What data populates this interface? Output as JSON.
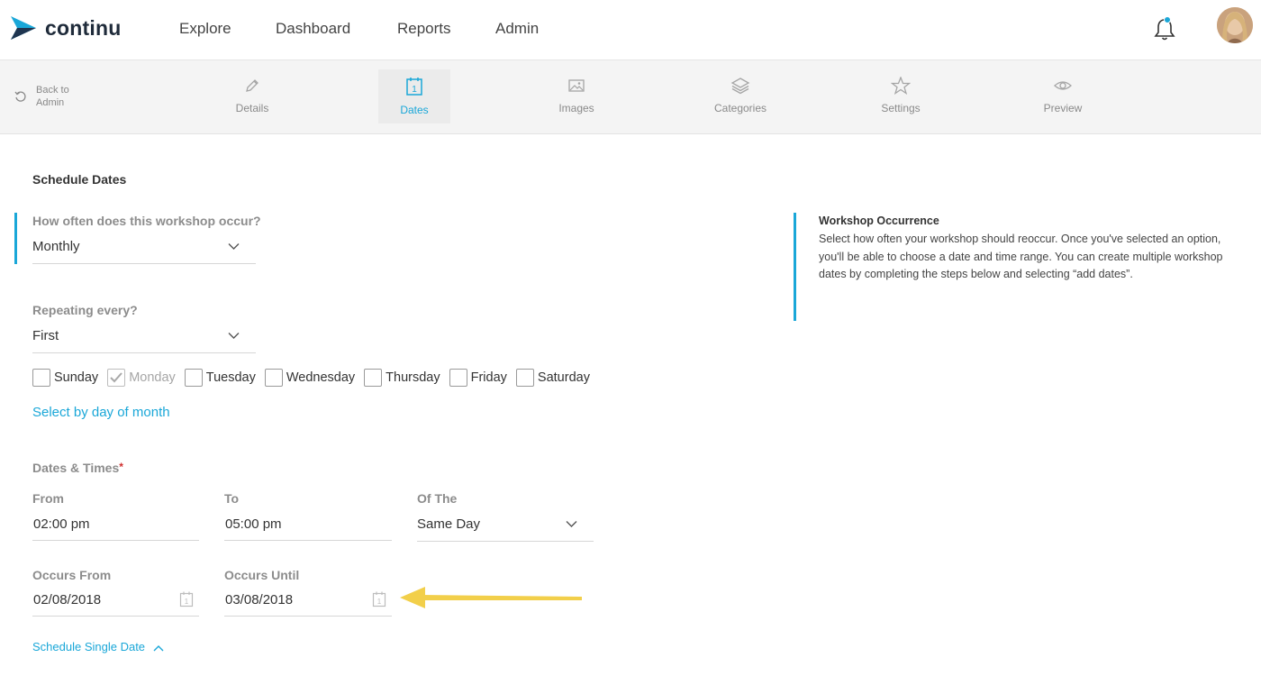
{
  "brand": {
    "name": "continu"
  },
  "nav": [
    "Explore",
    "Dashboard",
    "Reports",
    "Admin"
  ],
  "toolbar": {
    "back_label": "Back to Admin",
    "steps": [
      {
        "label": "Details",
        "icon": "pencil-icon"
      },
      {
        "label": "Dates",
        "icon": "calendar-icon",
        "active": true
      },
      {
        "label": "Images",
        "icon": "image-icon"
      },
      {
        "label": "Categories",
        "icon": "layers-icon"
      },
      {
        "label": "Settings",
        "icon": "star-icon"
      },
      {
        "label": "Preview",
        "icon": "eye-icon"
      }
    ]
  },
  "form": {
    "section_title": "Schedule Dates",
    "occurrence": {
      "label": "How often does this workshop occur?",
      "value": "Monthly"
    },
    "repeating": {
      "label": "Repeating every?",
      "value": "First"
    },
    "days": [
      {
        "label": "Sunday",
        "checked": false
      },
      {
        "label": "Monday",
        "checked": true
      },
      {
        "label": "Tuesday",
        "checked": false
      },
      {
        "label": "Wednesday",
        "checked": false
      },
      {
        "label": "Thursday",
        "checked": false
      },
      {
        "label": "Friday",
        "checked": false
      },
      {
        "label": "Saturday",
        "checked": false
      }
    ],
    "select_by_day_link": "Select by day of month",
    "dates_times_label": "Dates & Times",
    "required_mark": "*",
    "from": {
      "label": "From",
      "value": "02:00  pm"
    },
    "to": {
      "label": "To",
      "value": "05:00  pm"
    },
    "of_the": {
      "label": "Of The",
      "value": "Same Day"
    },
    "occurs_from": {
      "label": "Occurs From",
      "value": "02/08/2018"
    },
    "occurs_until": {
      "label": "Occurs Until",
      "value": "03/08/2018"
    },
    "schedule_single_link": "Schedule Single Date"
  },
  "info": {
    "title": "Workshop Occurrence",
    "body": "Select how often your workshop should reoccur. Once you've selected an option, you'll be able to choose a date and time range. You can create multiple workshop dates by completing the steps below and selecting “add dates”."
  },
  "colors": {
    "accent": "#1aa7d8",
    "arrow": "#f2cf4a",
    "required": "#d0302f"
  }
}
